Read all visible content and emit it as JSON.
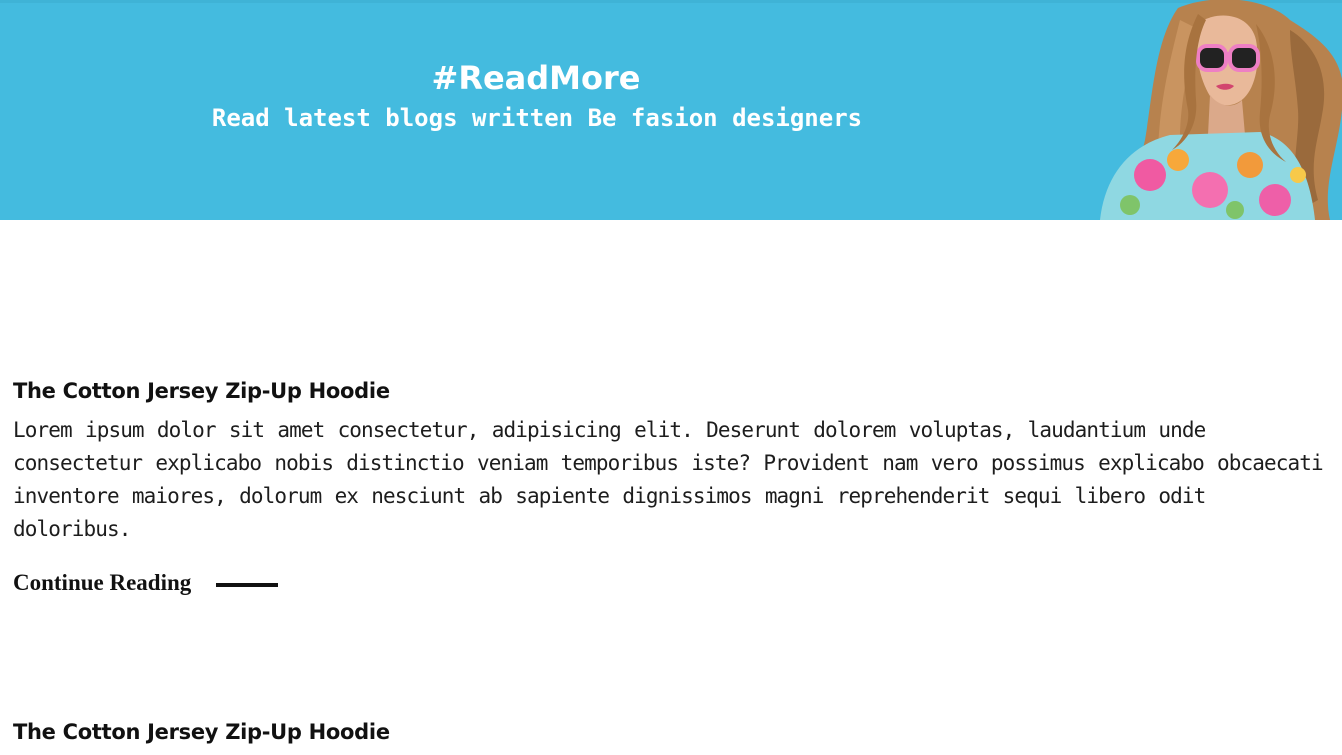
{
  "banner": {
    "title": "#ReadMore",
    "subtitle": "Read latest blogs written Be fasion designers",
    "background_color": "#44bbdf",
    "image": "woman-with-pink-sunglasses-floral-dress"
  },
  "articles": [
    {
      "title": "The Cotton Jersey Zip-Up Hoodie",
      "body": "Lorem ipsum dolor sit amet consectetur, adipisicing elit. Deserunt dolorem voluptas, laudantium unde consectetur explicabo nobis distinctio veniam temporibus iste? Provident nam vero possimus explicabo obcaecati inventore maiores, dolorum ex nesciunt ab sapiente dignissimos magni reprehenderit sequi libero odit doloribus.",
      "link_label": "Continue Reading"
    },
    {
      "title": "The Cotton Jersey Zip-Up Hoodie"
    }
  ]
}
